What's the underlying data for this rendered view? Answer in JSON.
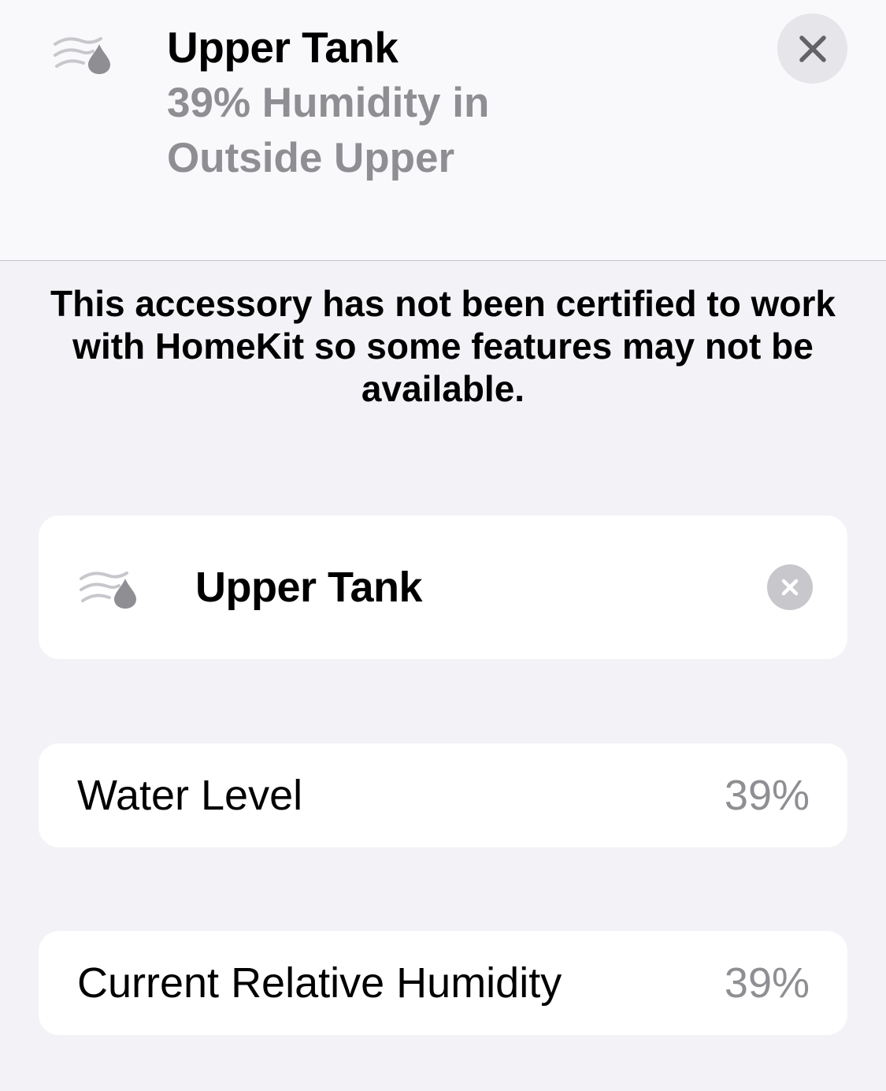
{
  "header": {
    "icon": "humidity-sensor-icon",
    "title": "Upper Tank",
    "subtitle": "39% Humidity in Outside Upper",
    "close_icon": "close-icon"
  },
  "notice": {
    "text": "This accessory has not been certified to work with HomeKit so some features may not be available."
  },
  "name_card": {
    "icon": "humidity-sensor-icon",
    "name": "Upper Tank",
    "clear_icon": "clear-text-icon"
  },
  "rows": [
    {
      "label": "Water Level",
      "value": "39%"
    },
    {
      "label": "Current Relative Humidity",
      "value": "39%"
    }
  ],
  "colors": {
    "background": "#f2f2f7",
    "header_background": "#f9f9fb",
    "secondary_text": "#8e8e93",
    "icon_gray": "#8e8e93"
  }
}
